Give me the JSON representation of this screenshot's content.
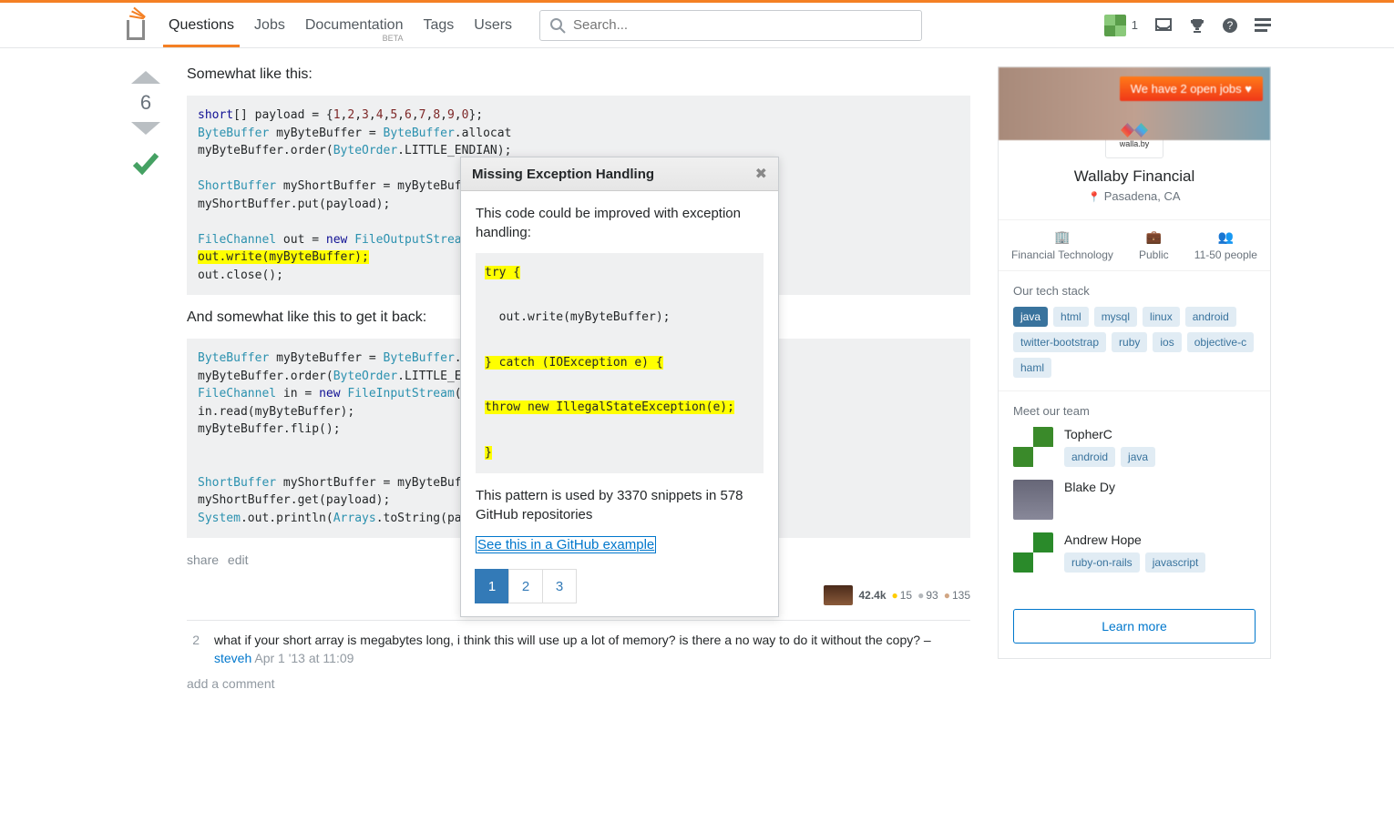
{
  "nav": {
    "items": [
      "Questions",
      "Jobs",
      "Documentation",
      "Tags",
      "Users"
    ],
    "active": 0,
    "beta": "BETA"
  },
  "search": {
    "placeholder": "Search..."
  },
  "user": {
    "rep": "1"
  },
  "answer": {
    "vote": "6",
    "para1": "Somewhat like this:",
    "para2": "And somewhat like this to get it back:",
    "share": "share",
    "edit": "edit"
  },
  "stats": {
    "rep": "42.4k",
    "gold": "15",
    "silver": "93",
    "bronze": "135"
  },
  "comment": {
    "score": "2",
    "text": "what if your short array is megabytes long, i think this will use up a lot of memory? is there a no way to do it without the copy? – ",
    "user": "steveh",
    "date": "Apr 1 '13 at 11:09",
    "add": "add a comment"
  },
  "tooltip": {
    "title": "Missing Exception Handling",
    "intro": "This code could be improved with exception handling:",
    "l1": "try {",
    "l2": "  out.write(myByteBuffer);",
    "l3": "} catch (IOException e) {",
    "l4": "throw new IllegalStateException(e);",
    "l5": "}",
    "outro": "This pattern is used by 3370 snippets in 578 GitHub repositories",
    "link": "See this in a GitHub example",
    "pages": [
      "1",
      "2",
      "3"
    ]
  },
  "job": {
    "pill": "We have 2 open jobs ♥",
    "logo_text": "walla.by",
    "company": "Wallaby Financial",
    "location": "Pasadena, CA",
    "stats": [
      {
        "label": "Financial Technology",
        "icon": "🏢"
      },
      {
        "label": "Public",
        "icon": "💼"
      },
      {
        "label": "11-50 people",
        "icon": "👥"
      }
    ],
    "stack_title": "Our tech stack",
    "stack": [
      "java",
      "html",
      "mysql",
      "linux",
      "android",
      "twitter-bootstrap",
      "ruby",
      "ios",
      "objective-c",
      "haml"
    ],
    "team_title": "Meet our team",
    "team": [
      {
        "name": "TopherC",
        "tags": [
          "android",
          "java"
        ]
      },
      {
        "name": "Blake Dy",
        "tags": []
      },
      {
        "name": "Andrew Hope",
        "tags": [
          "ruby-on-rails",
          "javascript"
        ]
      }
    ],
    "learn": "Learn more"
  }
}
